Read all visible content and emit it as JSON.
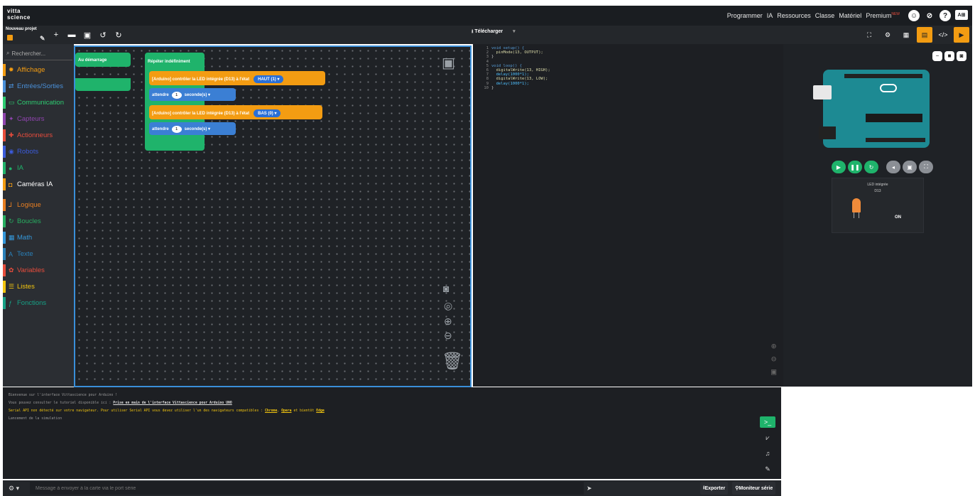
{
  "app": {
    "logo_line1": "vitta",
    "logo_line2": "science"
  },
  "nav": {
    "links": [
      "Programmer",
      "IA",
      "Ressources",
      "Classe",
      "Matériel",
      "Premium"
    ],
    "premium_badge": "NEW",
    "icons": [
      "user-icon",
      "eye-off-icon",
      "help-icon",
      "language-icon"
    ],
    "language": "A"
  },
  "toolbar": {
    "project_title": "Nouveau projet",
    "download_label": "Télécharger",
    "buttons": [
      "add-icon",
      "open-folder-icon",
      "save-icon",
      "undo-icon",
      "redo-icon"
    ]
  },
  "sidebar": {
    "search_placeholder": "Rechercher...",
    "categories": [
      {
        "label": "Affichage",
        "color": "#f39c12",
        "icon": "display-icon"
      },
      {
        "label": "Entrées/Sorties",
        "color": "#4a90d9",
        "icon": "io-icon"
      },
      {
        "label": "Communication",
        "color": "#2ecc71",
        "icon": "chat-icon"
      },
      {
        "label": "Capteurs",
        "color": "#8e44ad",
        "icon": "sensor-icon"
      },
      {
        "label": "Actionneurs",
        "color": "#e74c3c",
        "icon": "actuator-icon"
      },
      {
        "label": "Robots",
        "color": "#3b5bdb",
        "icon": "robot-icon"
      },
      {
        "label": "IA",
        "color": "#1fb36b",
        "icon": "ai-icon"
      },
      {
        "label": "Caméras IA",
        "color": "#f39c12",
        "icon": "camera-ai-icon"
      },
      {
        "label": "Logique",
        "color": "#e67e22",
        "icon": "logic-icon"
      },
      {
        "label": "Boucles",
        "color": "#27ae60",
        "icon": "loop-icon"
      },
      {
        "label": "Math",
        "color": "#3498db",
        "icon": "math-icon"
      },
      {
        "label": "Texte",
        "color": "#2980b9",
        "icon": "text-icon"
      },
      {
        "label": "Variables",
        "color": "#e74c3c",
        "icon": "variables-icon"
      },
      {
        "label": "Listes",
        "color": "#f1c40f",
        "icon": "list-icon"
      },
      {
        "label": "Fonctions",
        "color": "#16a085",
        "icon": "function-icon"
      }
    ]
  },
  "workspace": {
    "on_start": "Au démarrage",
    "repeat_forever": "Répéter indéfiniment",
    "led_block_1": "[Arduino] contrôler la LED intégrée (D13) à l'état",
    "led_state_1": "HAUT (1) ▾",
    "wait_block": "attendre",
    "wait_value": "1",
    "wait_unit": "seconde(s) ▾",
    "led_block_2": "[Arduino] contrôler la LED intégrée (D13) à l'état",
    "led_state_2": "BAS (0) ▾"
  },
  "code": {
    "lines": [
      "void setup() {",
      "  pinMode(13, OUTPUT);",
      "}",
      "",
      "void loop() {",
      "  digitalWrite(13, HIGH);",
      "  delay(1000*1);",
      "  digitalWrite(13, LOW);",
      "  delay(1000*1);",
      "}"
    ]
  },
  "simulator": {
    "led_label": "LED intégrée",
    "led_pin": "D13",
    "led_state": "ON",
    "accent_green": "#1fb36b"
  },
  "console": {
    "welcome": "Bienvenue sur l'interface Vittascience pour Arduino !",
    "tutorial_prefix": "Vous pouvez consulter le tutoriel disponible ici :",
    "tutorial_link": "Prise en main de l'interface Vittascience pour Arduino UNO",
    "warning_prefix": "Serial API non détecté sur votre navigateur. Pour utiliser Serial API vous devez utiliser l'un des navigateurs compatibles :",
    "browser_1": "Chrome",
    "browser_2": "Opera",
    "browser_and": "et bientôt",
    "browser_3": "Edge",
    "launch": "Lancement de la simulation"
  },
  "bottom": {
    "message_placeholder": "Message à envoyer à la carte via le port série",
    "export_label": "Exporter",
    "monitor_label": "Moniteur série"
  }
}
